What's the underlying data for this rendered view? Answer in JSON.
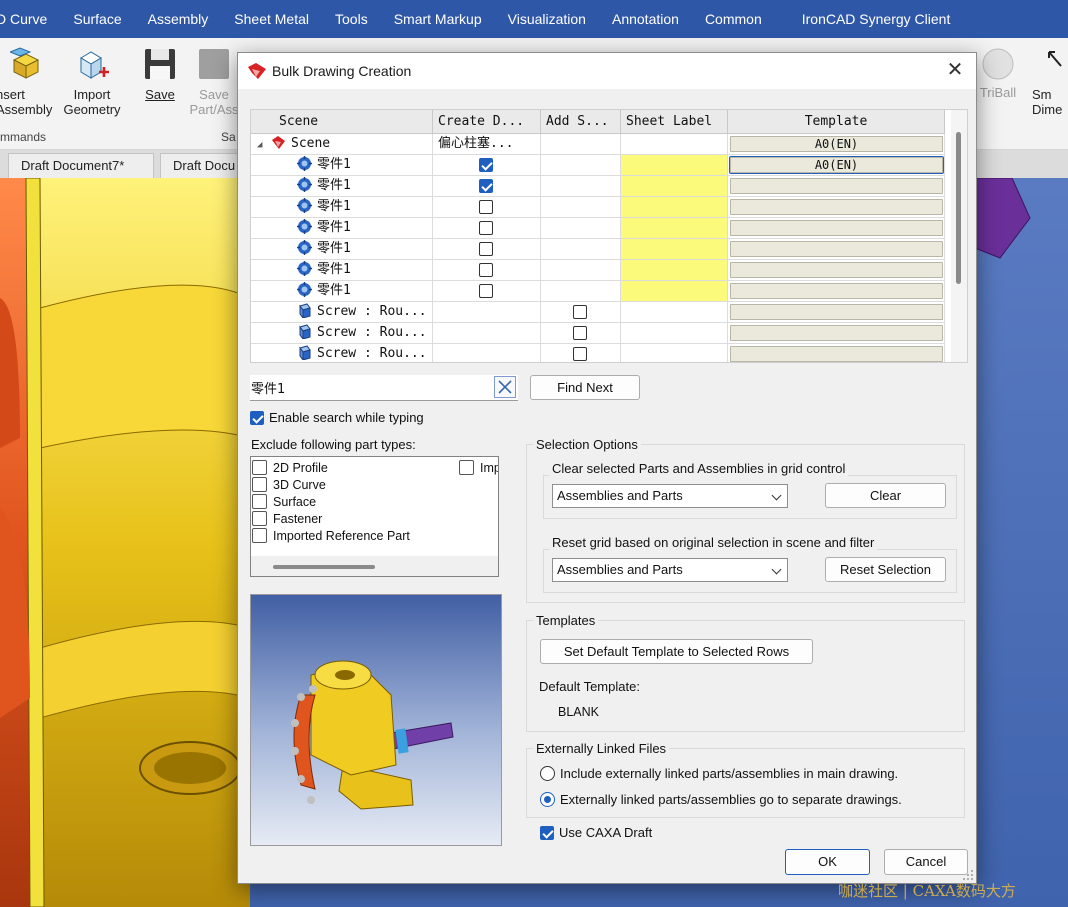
{
  "menubar": {
    "items": [
      "D Curve",
      "Surface",
      "Assembly",
      "Sheet Metal",
      "Tools",
      "Smart Markup",
      "Visualization",
      "Annotation",
      "Common",
      "IronCAD Synergy Client"
    ]
  },
  "ribbon": {
    "insert_assembly": "nsert\nAssembly",
    "import_geometry": "Import\nGeometry",
    "save": "Save",
    "save_part": "Save\nPart/Ass",
    "triball": "TriBall",
    "smart_dim": "Sm\nDime",
    "group_commands": "mmands",
    "group_save": "Sa"
  },
  "doc_tabs": [
    "Draft Document7*",
    "Draft Docu"
  ],
  "dialog": {
    "title": "Bulk Drawing Creation",
    "grid": {
      "headers": [
        "Scene",
        "Create D...",
        "Add S...",
        "Sheet Label",
        "Template"
      ],
      "rows": [
        {
          "name": "Scene",
          "create": "偏心柱塞...",
          "template": "A0(EN)",
          "type": "scene"
        },
        {
          "name": "零件1",
          "create_checked": true,
          "template": "A0(EN)",
          "type": "part"
        },
        {
          "name": "零件1",
          "create_checked": true,
          "template": "",
          "type": "part"
        },
        {
          "name": "零件1",
          "create_checked": false,
          "template": "",
          "type": "part"
        },
        {
          "name": "零件1",
          "create_checked": false,
          "template": "",
          "type": "part"
        },
        {
          "name": "零件1",
          "create_checked": false,
          "template": "",
          "type": "part"
        },
        {
          "name": "零件1",
          "create_checked": false,
          "template": "",
          "type": "part"
        },
        {
          "name": "零件1",
          "create_checked": false,
          "template": "",
          "type": "part"
        },
        {
          "name": "Screw : Rou...",
          "add_checked": false,
          "template": "",
          "type": "screw"
        },
        {
          "name": "Screw : Rou...",
          "add_checked": false,
          "template": "",
          "type": "screw"
        },
        {
          "name": "Screw : Rou...",
          "add_checked": false,
          "template": "",
          "type": "screw"
        }
      ]
    },
    "search": {
      "value": "零件1",
      "find_next": "Find Next"
    },
    "enable_search_label": "Enable search while typing",
    "exclude_label": "Exclude following part types:",
    "exclude_items": [
      "2D Profile",
      "3D Curve",
      "Surface",
      "Fastener",
      "Imported Reference Part",
      "Imp"
    ],
    "selection_options": {
      "title": "Selection Options",
      "clear_title": "Clear selected Parts and Assemblies in grid control",
      "clear_combo": "Assemblies and Parts",
      "clear_button": "Clear",
      "reset_title": "Reset grid based on original selection in scene and filter",
      "reset_combo": "Assemblies and Parts",
      "reset_button": "Reset Selection"
    },
    "templates": {
      "title": "Templates",
      "set_default_button": "Set Default Template to Selected Rows",
      "default_label": "Default Template:",
      "default_value": "BLANK"
    },
    "external": {
      "title": "Externally Linked Files",
      "option_main": "Include externally linked parts/assemblies in main drawing.",
      "option_separate": "Externally linked parts/assemblies go to separate drawings."
    },
    "use_caxa_label": "Use CAXA Draft",
    "ok": "OK",
    "cancel": "Cancel"
  },
  "watermark": "咖迷社区 | CAXA数码大方",
  "colors": {
    "menubar": "#2f57a8",
    "accent": "#1f5fbf",
    "sheet_label_yellow": "#fbfa7a",
    "part_gold": "#e8c21a",
    "part_orange": "#e0541e"
  }
}
